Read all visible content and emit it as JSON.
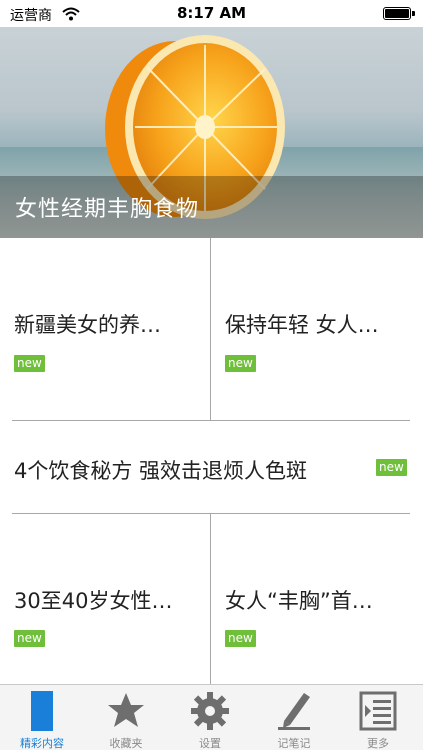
{
  "status_bar": {
    "carrier": "运营商",
    "time": "8:17 AM",
    "battery_percent": 100
  },
  "hero": {
    "caption": "女性经期丰胸食物"
  },
  "articles": [
    {
      "title": "新疆美女的养…",
      "badge": "new"
    },
    {
      "title": "保持年轻 女人…",
      "badge": "new"
    },
    {
      "title": "4个饮食秘方 强效击退烦人色斑",
      "badge": "new"
    },
    {
      "title": "30至40岁女性…",
      "badge": "new"
    },
    {
      "title": "女人“丰胸”首…",
      "badge": "new"
    }
  ],
  "tabbar": {
    "tabs": [
      {
        "label": "精彩内容",
        "icon": "featured-icon",
        "active": true
      },
      {
        "label": "收藏夹",
        "icon": "star-icon",
        "active": false
      },
      {
        "label": "设置",
        "icon": "gear-icon",
        "active": false
      },
      {
        "label": "记笔记",
        "icon": "pen-icon",
        "active": false
      },
      {
        "label": "更多",
        "icon": "more-list-icon",
        "active": false
      }
    ]
  },
  "colors": {
    "active_tab": "#1a7fd8",
    "badge": "#6fbf3b",
    "divider": "#a8a8a8"
  }
}
